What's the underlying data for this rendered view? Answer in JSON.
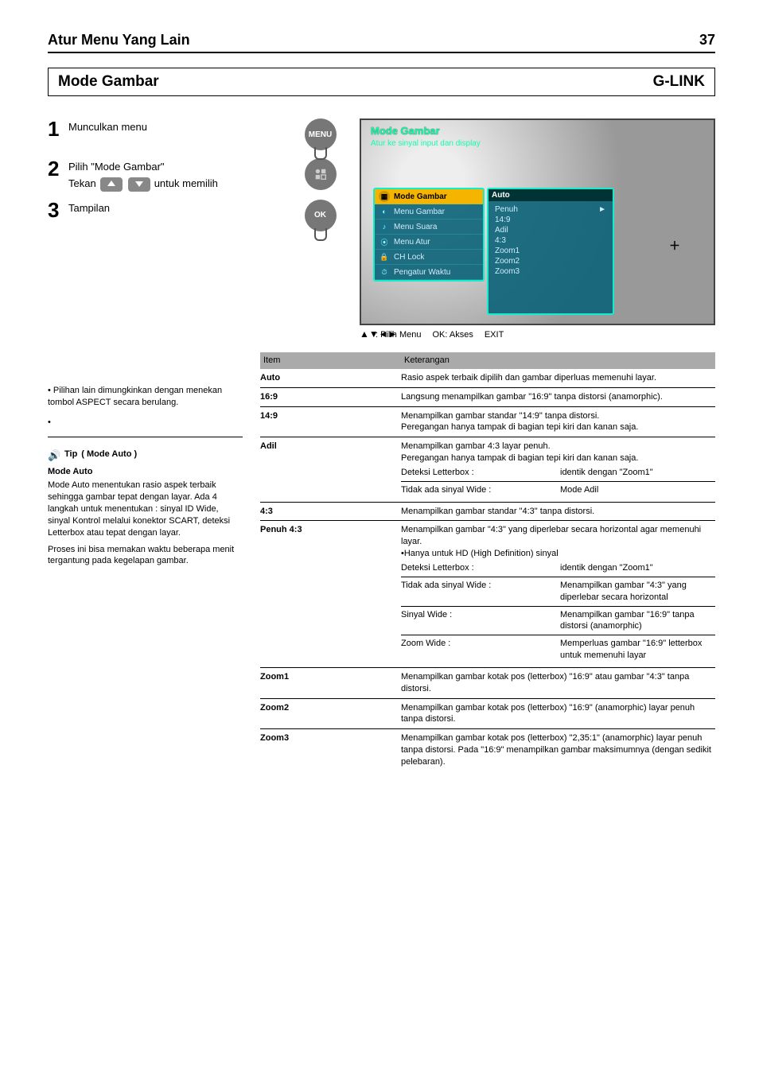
{
  "header": {
    "title": "Atur Menu Yang Lain",
    "page": "37"
  },
  "section_box": {
    "left": "Mode Gambar",
    "right": "G-LINK"
  },
  "steps1": {
    "num": "1",
    "text": "Munculkan menu"
  },
  "steps2": {
    "num": "2",
    "text1": "Pilih",
    "text2": "\"Mode Gambar\"",
    "note1": "Tekan ",
    "note2": "untuk memilih"
  },
  "steps3": {
    "num": "3",
    "text": "Tampilan"
  },
  "icons": {
    "menu": "MENU",
    "ok": "OK"
  },
  "screenshot": {
    "title": "Mode Gambar",
    "subtitle": "Atur ke sinyal input dan display",
    "left_items": [
      "Mode Gambar",
      "Menu Gambar",
      "Menu Suara",
      "Menu Atur",
      "CH Lock",
      "Pengatur Waktu"
    ],
    "right_title": "Auto",
    "wide_rows": [
      [
        "Penuh",
        "►"
      ],
      [
        "14:9",
        ""
      ],
      [
        "Adil",
        ""
      ],
      [
        "4:3",
        ""
      ],
      [
        "Zoom1",
        ""
      ],
      [
        "Zoom2",
        ""
      ],
      [
        "Zoom3",
        ""
      ]
    ],
    "hint1": ": Pilih Menu",
    "hint2": "OK: Akses",
    "hint3": "EXIT"
  },
  "left_notes": {
    "b1": "• Pilihan lain dimungkinkan dengan menekan tombol ASPECT secara berulang.",
    "b2": "•",
    "tip_title": "Tip",
    "tip_sound": "(  Mode Auto  )",
    "tip_auto_title": "Mode Auto",
    "tip_auto_body": "Mode Auto menentukan rasio aspek terbaik sehingga gambar tepat dengan layar. Ada 4 langkah untuk menentukan : sinyal ID Wide, sinyal Kontrol melalui konektor SCART, deteksi Letterbox atau tepat dengan layar.",
    "tip_note": "Proses ini bisa memakan waktu beberapa menit tergantung pada kegelapan gambar."
  },
  "table": {
    "head_item": "Item",
    "head_desc": "Keterangan",
    "rows": [
      {
        "item": "Auto",
        "desc": "Rasio aspek terbaik dipilih dan gambar diperluas memenuhi layar."
      },
      {
        "item": "16:9",
        "desc": "Langsung menampilkan gambar \"16:9\" tanpa distorsi (anamorphic)."
      },
      {
        "item": "14:9",
        "desc_lines": [
          "Menampilkan gambar standar \"14:9\" tanpa distorsi.",
          "Peregangan hanya tampak di bagian tepi kiri dan kanan saja."
        ]
      },
      {
        "item": "Adil",
        "desc_lines": [
          "Menampilkan gambar 4:3 layar penuh.",
          "Peregangan hanya tampak di bagian tepi kiri dan kanan saja."
        ],
        "sub": [
          {
            "label": "Deteksi Letterbox :",
            "value": "identik dengan \"Zoom1\""
          },
          {
            "label": "Tidak ada sinyal Wide :",
            "value": "Mode Adil"
          }
        ]
      },
      {
        "item": "4:3",
        "desc_lines": [
          "Menampilkan gambar standar \"4:3\" tanpa distorsi."
        ]
      },
      {
        "item": "Penuh 4:3",
        "desc_lines": [
          "Menampilkan gambar \"4:3\" yang diperlebar secara horizontal agar memenuhi layar.",
          "•Hanya untuk HD (High Definition) sinyal"
        ],
        "sub": [
          {
            "label": "Deteksi Letterbox :",
            "value": "identik dengan \"Zoom1\""
          },
          {
            "label": "Tidak ada sinyal Wide :",
            "value": "Menampilkan gambar \"4:3\" yang diperlebar secara horizontal"
          },
          {
            "label": "Sinyal Wide :",
            "value": "Menampilkan gambar \"16:9\" tanpa distorsi (anamorphic)"
          },
          {
            "label": "Zoom Wide :",
            "value": "Memperluas gambar \"16:9\" letterbox untuk memenuhi layar"
          }
        ]
      },
      {
        "item": "Zoom1",
        "desc": "Menampilkan gambar kotak pos (letterbox) \"16:9\" atau gambar \"4:3\" tanpa distorsi."
      },
      {
        "item": "Zoom2",
        "desc": "Menampilkan gambar kotak pos (letterbox) \"16:9\" (anamorphic) layar penuh tanpa distorsi."
      },
      {
        "item": "Zoom3",
        "desc": "Menampilkan gambar kotak pos (letterbox) \"2,35:1\" (anamorphic) layar penuh tanpa distorsi. Pada \"16:9\" menampilkan gambar maksimumnya (dengan sedikit pelebaran)."
      }
    ]
  }
}
